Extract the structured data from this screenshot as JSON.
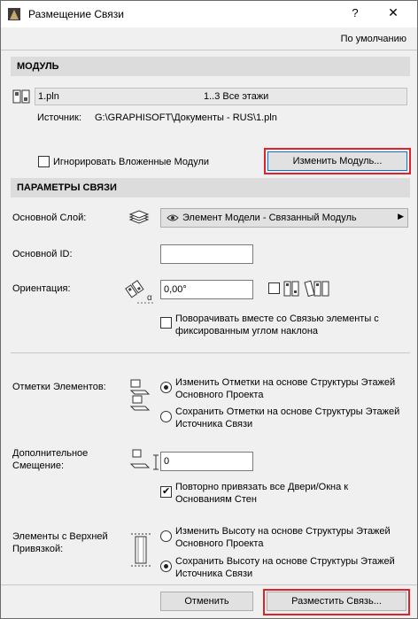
{
  "window": {
    "title": "Размещение Связи",
    "help": "?",
    "close": "✕"
  },
  "defaults_label": "По умолчанию",
  "module_section": {
    "header": "МОДУЛЬ",
    "file_name": "1.pln",
    "stories": "1..3 Все этажи",
    "source_label": "Источник:",
    "source_path": "G:\\GRAPHISOFT\\Документы - RUS\\1.pln",
    "ignore_nested_label": "Игнорировать Вложенные Модули",
    "ignore_nested_checked": false,
    "change_module_button": "Изменить Модуль..."
  },
  "link_params": {
    "header": "ПАРАМЕТРЫ СВЯЗИ",
    "master_layer_label": "Основной Слой:",
    "master_layer_value": "Элемент Модели - Связанный Модуль",
    "master_id_label": "Основной ID:",
    "master_id_value": "",
    "orientation_label": "Ориентация:",
    "orientation_value": "0,00°",
    "orientation_checkbox_checked": false,
    "rotate_with_link_label": "Поворачивать вместе со Связью элементы с фиксированным углом наклона",
    "rotate_with_link_checked": false,
    "elevations_label": "Отметки Элементов:",
    "elevations_options": [
      {
        "text": "Изменить Отметки на основе Структуры Этажей Основного Проекта",
        "selected": true
      },
      {
        "text": "Сохранить Отметки на основе Структуры Этажей Источника Связи",
        "selected": false
      }
    ],
    "offset_label": "Дополнительное Смещение:",
    "offset_value": "0",
    "reconnect_label": "Повторно привязать все Двери/Окна к Основаниям Стен",
    "reconnect_checked": true,
    "top_linked_label": "Элементы с Верхней Привязкой:",
    "top_linked_options": [
      {
        "text": "Изменить Высоту на основе Структуры Этажей Основного Проекта",
        "selected": false
      },
      {
        "text": "Сохранить Высоту на основе Структуры Этажей Источника Связи",
        "selected": true
      }
    ]
  },
  "footer": {
    "cancel_button": "Отменить",
    "place_button": "Разместить Связь..."
  }
}
